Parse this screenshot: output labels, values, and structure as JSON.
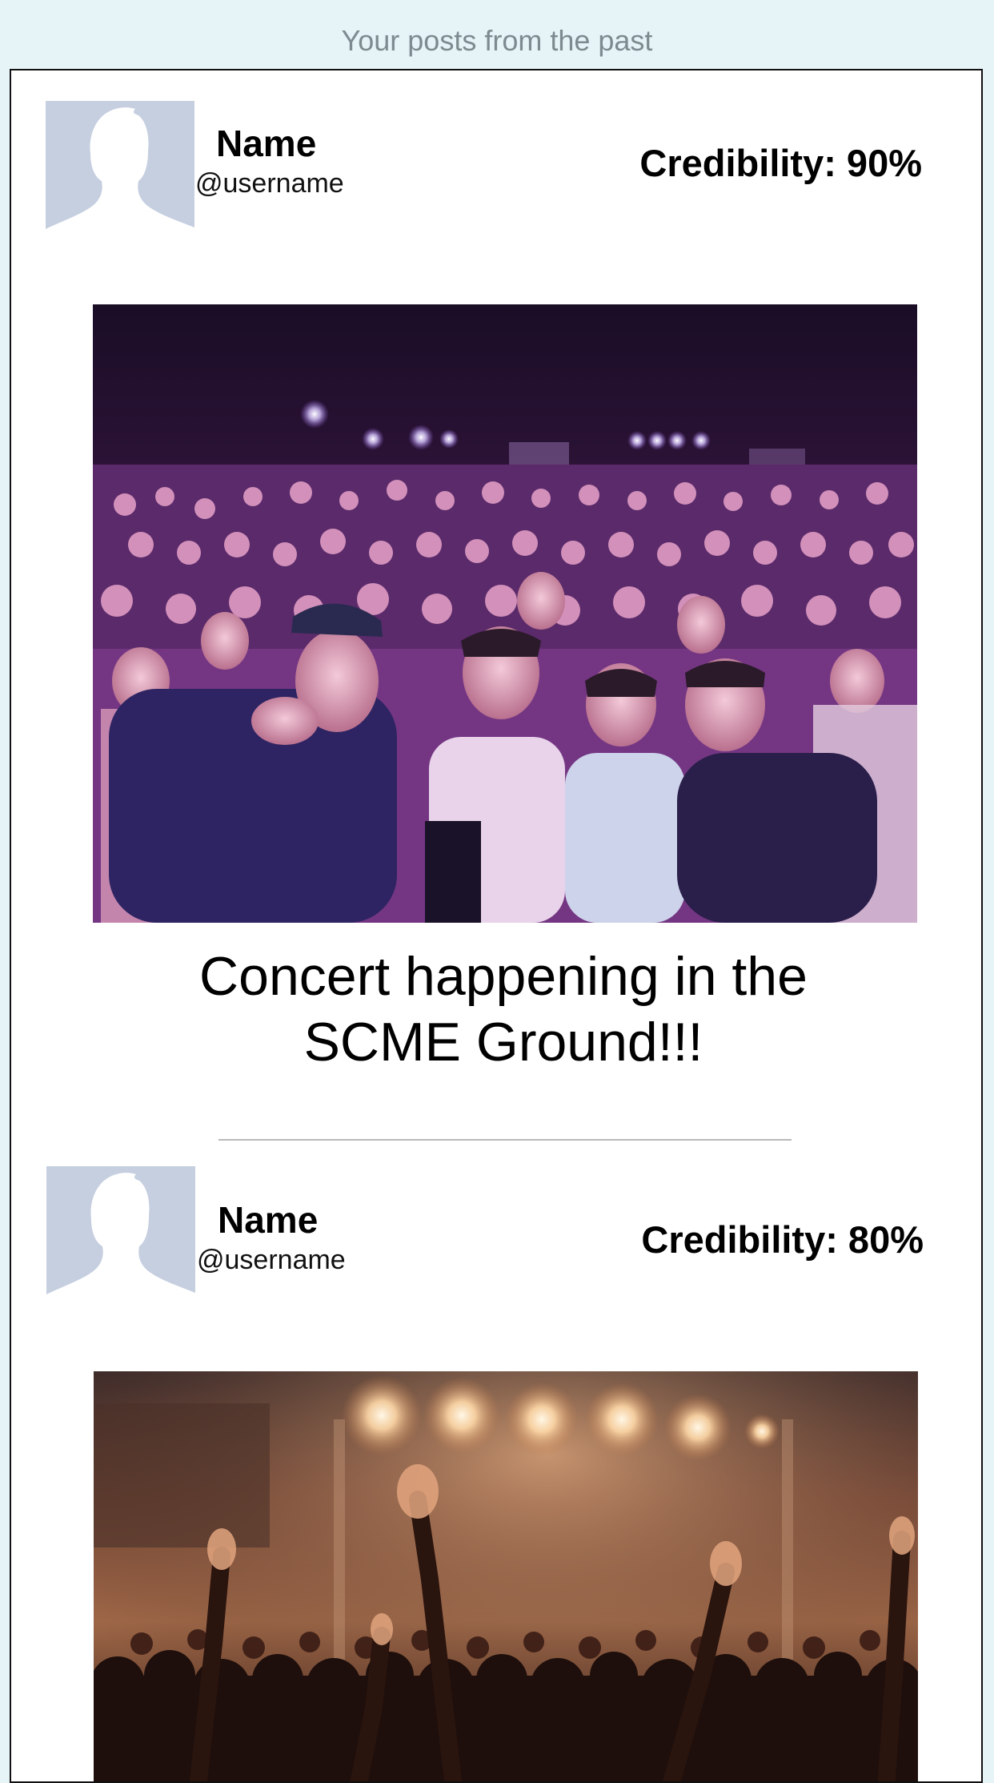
{
  "header": {
    "title": "Your posts from the past"
  },
  "posts": [
    {
      "name": "Name",
      "username": "@username",
      "credibility": "Credibility: 90%",
      "image_icon": "concert-selfie-photo",
      "caption": "Concert happening in the SCME Ground!!!"
    },
    {
      "name": "Name",
      "username": "@username",
      "credibility": "Credibility: 80%",
      "image_icon": "concert-crowd-photo"
    }
  ],
  "colors": {
    "background": "#e6f3f7",
    "card": "#ffffff",
    "avatar_bg": "#c6cfe0",
    "header_text": "#7d8a8f"
  }
}
